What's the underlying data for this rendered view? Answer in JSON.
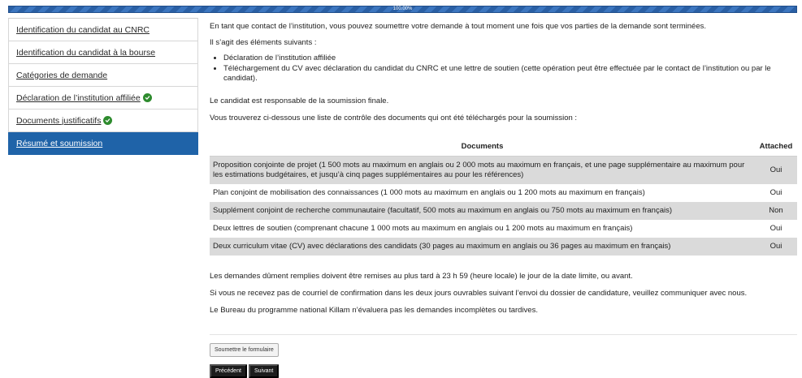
{
  "progress": {
    "label": "100.00%",
    "value_percent": 100
  },
  "sidebar": {
    "items": [
      {
        "label": "Identification du candidat au CNRC",
        "completed": false,
        "active": false
      },
      {
        "label": "Identification du candidat à la bourse",
        "completed": false,
        "active": false
      },
      {
        "label": "Catégories de demande",
        "completed": false,
        "active": false
      },
      {
        "label": "Déclaration de l’institution affiliée",
        "completed": true,
        "active": false
      },
      {
        "label": "Documents justificatifs",
        "completed": true,
        "active": false
      },
      {
        "label": "Résumé et soumission",
        "completed": false,
        "active": true
      }
    ]
  },
  "main": {
    "intro": "En tant que contact de l’institution, vous pouvez soumettre votre demande à tout moment une fois que vos parties de la demande sont terminées.",
    "elements_heading": "Il s’agit des éléments suivants :",
    "bullets": [
      "Déclaration de l’institution affiliée",
      "Téléchargement du CV avec déclaration du candidat du CNRC et une lettre de soutien (cette opération peut être effectuée par le contact de l’institution ou par le candidat)."
    ],
    "final_note": "Le candidat est responsable de la soumission finale.",
    "checklist_intro": "Vous trouverez ci-dessous une liste de contrôle des documents qui ont été téléchargés pour la soumission :",
    "table": {
      "headers": {
        "documents": "Documents",
        "attached": "Attached"
      },
      "rows": [
        {
          "document": "Proposition conjointe de projet (1 500 mots au maximum en anglais ou 2 000 mots au maximum en français, et une page supplémentaire au maximum pour les estimations budgétaires, et jusqu’à cinq pages supplémentaires au pour les références)",
          "attached": "Oui"
        },
        {
          "document": "Plan conjoint de mobilisation des connaissances (1 000 mots au maximum en anglais ou 1 200 mots au maximum en français)",
          "attached": "Oui"
        },
        {
          "document": "Supplément conjoint de recherche communautaire (facultatif, 500 mots au maximum en anglais ou 750 mots au maximum en français)",
          "attached": "Non"
        },
        {
          "document": "Deux lettres de soutien (comprenant chacune 1 000 mots au maximum en anglais ou 1 200 mots au maximum en français)",
          "attached": "Oui"
        },
        {
          "document": "Deux curriculum vitae (CV) avec déclarations des candidats (30 pages au maximum en anglais ou 36 pages au maximum en français)",
          "attached": "Oui"
        }
      ]
    },
    "deadline_note": "Les demandes dûment remplies doivent être remises au plus tard à 23 h 59 (heure locale) le jour de la date limite, ou avant.",
    "confirmation_note": "Si vous ne recevez pas de courriel de confirmation dans les deux jours ouvrables suivant l’envoi du dossier de candidature, veuillez communiquer avec nous.",
    "bureau_note": "Le Bureau du programme national Killam n’évaluera pas les demandes incomplètes ou tardives."
  },
  "buttons": {
    "submit": "Soumettre le formulaire",
    "previous": "Précédent",
    "next": "Suivant"
  },
  "colors": {
    "progress": "#2a5fa4",
    "active_nav": "#1f63a8",
    "check": "#2e8b2e",
    "row_shade": "#dadada",
    "nav_button": "#1d1d1d"
  },
  "icons": {
    "completed": "check-circle-icon"
  }
}
